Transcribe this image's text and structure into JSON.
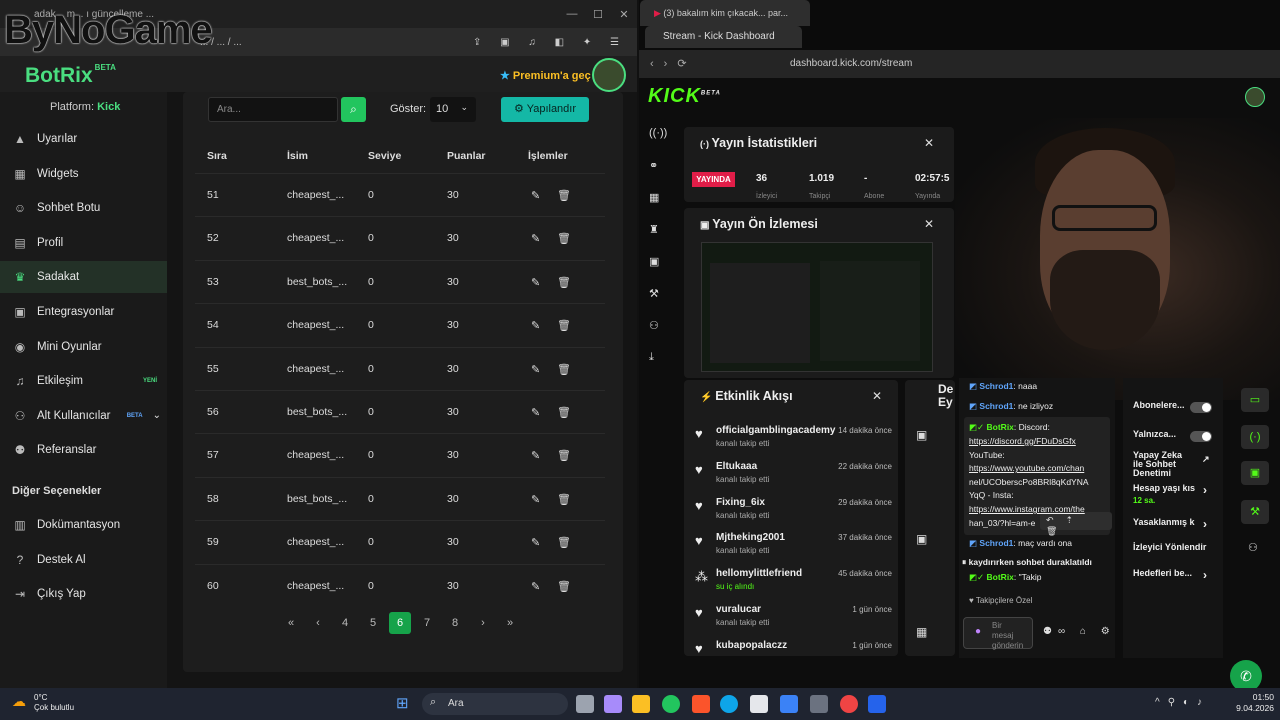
{
  "left_window": {
    "tab_title": "adak... m... ı güncelleme ...",
    "watermark": "ByNoGame",
    "url": "... / ... / ..."
  },
  "botrix": {
    "logo": "BotRix",
    "logo_badge": "BETA",
    "premium": "Premium'a geç",
    "platform_label": "Platform:",
    "platform_value": "Kick",
    "sidebar": [
      {
        "label": "Uyarılar",
        "icon": "warning-icon"
      },
      {
        "label": "Widgets",
        "icon": "grid-icon"
      },
      {
        "label": "Sohbet Botu",
        "icon": "robot-icon"
      },
      {
        "label": "Profil",
        "icon": "profile-card-icon"
      },
      {
        "label": "Sadakat",
        "icon": "trophy-icon",
        "active": true
      },
      {
        "label": "Entegrasyonlar",
        "icon": "integrations-icon"
      },
      {
        "label": "Mini Oyunlar",
        "icon": "gamepad-icon"
      },
      {
        "label": "Etkileşim",
        "icon": "music-icon",
        "badge": "YENİ"
      },
      {
        "label": "Alt Kullanıcılar",
        "icon": "users-icon",
        "badge": "BETA"
      },
      {
        "label": "Referanslar",
        "icon": "referral-icon"
      }
    ],
    "other_header": "Diğer Seçenekler",
    "other_items": [
      {
        "label": "Dokümantasyon",
        "icon": "docs-icon"
      },
      {
        "label": "Destek Al",
        "icon": "help-icon"
      },
      {
        "label": "Çıkış Yap",
        "icon": "logout-icon"
      }
    ],
    "search_placeholder": "Ara...",
    "show_label": "Göster:",
    "show_value": "10",
    "configure_button": "Yapılandır",
    "columns": [
      "Sıra",
      "İsim",
      "Seviye",
      "Puanlar",
      "İşlemler"
    ],
    "rows": [
      {
        "rank": "51",
        "name": "cheapest_...",
        "level": "0",
        "points": "30"
      },
      {
        "rank": "52",
        "name": "cheapest_...",
        "level": "0",
        "points": "30"
      },
      {
        "rank": "53",
        "name": "best_bots_...",
        "level": "0",
        "points": "30"
      },
      {
        "rank": "54",
        "name": "cheapest_...",
        "level": "0",
        "points": "30"
      },
      {
        "rank": "55",
        "name": "cheapest_...",
        "level": "0",
        "points": "30"
      },
      {
        "rank": "56",
        "name": "best_bots_...",
        "level": "0",
        "points": "30"
      },
      {
        "rank": "57",
        "name": "cheapest_...",
        "level": "0",
        "points": "30"
      },
      {
        "rank": "58",
        "name": "best_bots_...",
        "level": "0",
        "points": "30"
      },
      {
        "rank": "59",
        "name": "cheapest_...",
        "level": "0",
        "points": "30"
      },
      {
        "rank": "60",
        "name": "cheapest_...",
        "level": "0",
        "points": "30"
      }
    ],
    "pagination": [
      "«",
      "‹",
      "4",
      "5",
      "6",
      "7",
      "8",
      "›",
      "»"
    ],
    "current_page": "6"
  },
  "right_window": {
    "tab1": "(3) bakalım kim çıkacak... par...",
    "tab2": "Stream - Kick Dashboard",
    "url": "dashboard.kick.com/stream"
  },
  "kick": {
    "logo": "KICK",
    "logo_badge": "BETA",
    "stats_title": "Yayın İstatistikleri",
    "live_badge": "YAYINDA",
    "stats": [
      {
        "value": "36",
        "label": "İzleyici"
      },
      {
        "value": "1.019",
        "label": "Takipçi"
      },
      {
        "value": "-",
        "label": "Abone"
      },
      {
        "value": "02:57:5",
        "label": "Yayında"
      }
    ],
    "preview_title": "Yayın Ön İzlemesi",
    "feed_title": "Etkinlik Akışı",
    "feed": [
      {
        "name": "officialgamblingacademy",
        "sub": "kanalı takip etti",
        "time": "14 dakika önce"
      },
      {
        "name": "Eltukaaa",
        "sub": "kanalı takip etti",
        "time": "22 dakika önce"
      },
      {
        "name": "Fixing_6ix",
        "sub": "kanalı takip etti",
        "time": "29 dakika önce"
      },
      {
        "name": "Mjtheking2001",
        "sub": "kanalı takip etti",
        "time": "37 dakika önce"
      },
      {
        "name": "hellomylittlefriend",
        "sub": "su iç alındı",
        "time": "45 dakika önce"
      },
      {
        "name": "vuralucar",
        "sub": "kanalı takip etti",
        "time": "1 gün önce"
      },
      {
        "name": "kubapopalaczz",
        "sub": "",
        "time": "1 gün önce"
      }
    ],
    "de_panel": "De Ey",
    "chat": {
      "l1_user": "Schrod1",
      "l1_msg": ": naaa",
      "l2_user": "Schrod1",
      "l2_msg": ": ne izliyoz",
      "bot_user": "BotRix",
      "bot_msg": ": Discord:",
      "bot_lines": [
        "https://discord.gg/FDuDsGfx",
        "YouTube:",
        "https://www.youtube.com/chan",
        "nel/UCObersсPo8BRl8qKdYNA",
        "YqQ - Insta:",
        "https://www.instagram.com/the",
        "han_03/?hl=am-e"
      ],
      "l4_user": "Schrod1",
      "l4_msg": ": maç vardı ona",
      "paused": "kaydırırken sohbet duraklatıldı",
      "l5_user": "BotRix",
      "l5_msg": ": \"Takip",
      "followers_only": "Takipçilere Özel",
      "input_placeholder": "Bir mesaj gönderin"
    },
    "settings": [
      {
        "label": "Abonelere...",
        "type": "toggle"
      },
      {
        "label": "Yalnızca...",
        "type": "toggle"
      },
      {
        "label": "Yapay Zeka ile Sohbet Denetimi",
        "type": "link"
      },
      {
        "label": "Hesap yaşı kıs",
        "sub": "12 sa.",
        "type": "arrow"
      },
      {
        "label": "Yasaklanmış k",
        "type": "arrow"
      },
      {
        "label": "İzleyici Yönlendir",
        "type": "none"
      },
      {
        "label": "Hedefleri be...",
        "type": "arrow"
      }
    ]
  },
  "taskbar": {
    "weather_temp": "0°C",
    "weather_desc": "Çok bulutlu",
    "search": "Ara",
    "time": "01:50",
    "date": "9.04.2026"
  },
  "colors": {
    "botrix_green": "#4ade80",
    "kick_green": "#53fc18",
    "teal": "#14b8a6",
    "live_red": "#e11d48"
  }
}
